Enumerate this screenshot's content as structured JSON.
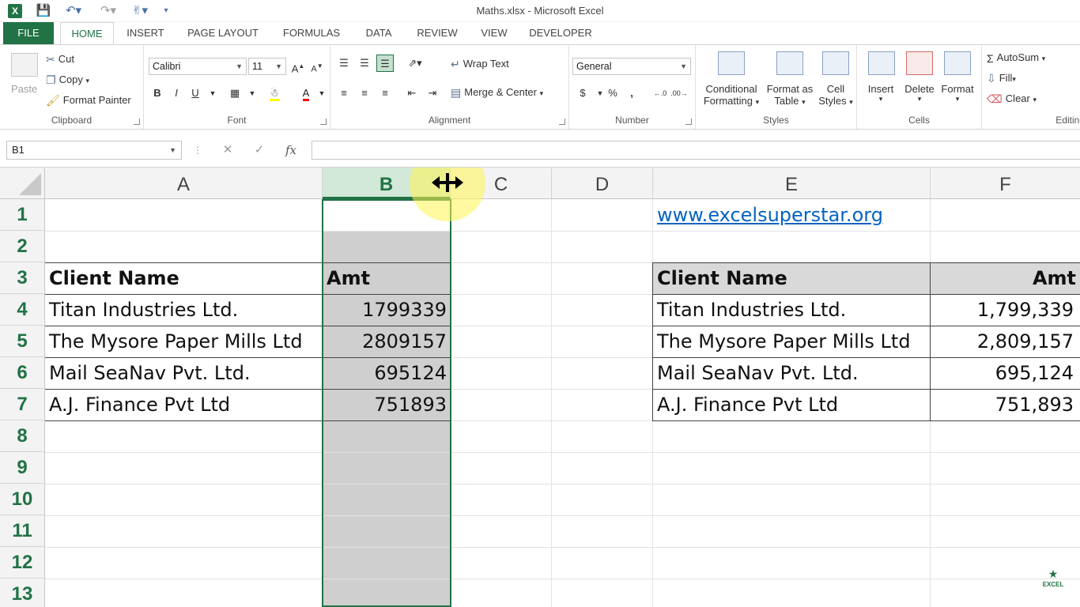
{
  "window": {
    "title": "Maths.xlsx - Microsoft Excel"
  },
  "ribbon_tabs": [
    {
      "label": "FILE"
    },
    {
      "label": "HOME"
    },
    {
      "label": "INSERT"
    },
    {
      "label": "PAGE LAYOUT"
    },
    {
      "label": "FORMULAS"
    },
    {
      "label": "DATA"
    },
    {
      "label": "REVIEW"
    },
    {
      "label": "VIEW"
    },
    {
      "label": "DEVELOPER"
    }
  ],
  "clipboard": {
    "paste": "Paste",
    "cut": "Cut",
    "copy": "Copy",
    "format_painter": "Format Painter",
    "label": "Clipboard"
  },
  "font": {
    "name": "Calibri",
    "size": "11",
    "bold": "B",
    "italic": "I",
    "underline": "U",
    "label": "Font"
  },
  "alignment": {
    "wrap_text": "Wrap Text",
    "merge_center": "Merge & Center",
    "label": "Alignment"
  },
  "number": {
    "format": "General",
    "currency": "$",
    "percent": "%",
    "comma": ",",
    "label": "Number"
  },
  "styles": {
    "conditional_1": "Conditional",
    "conditional_2": "Formatting",
    "format_table_1": "Format as",
    "format_table_2": "Table",
    "cell_styles_1": "Cell",
    "cell_styles_2": "Styles",
    "label": "Styles"
  },
  "cells": {
    "insert": "Insert",
    "delete": "Delete",
    "format": "Format",
    "label": "Cells"
  },
  "editing": {
    "autosum": "AutoSum",
    "fill": "Fill",
    "clear": "Clear",
    "label": "Editing"
  },
  "formula_bar": {
    "name_box": "B1",
    "fx": "fx",
    "formula": ""
  },
  "columns": [
    "A",
    "B",
    "C",
    "D",
    "E",
    "F"
  ],
  "rows": [
    "1",
    "2",
    "3",
    "4",
    "5",
    "6",
    "7",
    "8",
    "9",
    "10",
    "11",
    "12",
    "13"
  ],
  "sheet": {
    "link": "www.excelsuperstar.org",
    "left_table": {
      "headers": [
        "Client Name",
        "Amt"
      ],
      "rows": [
        [
          "Titan Industries Ltd.",
          "1799339"
        ],
        [
          "The Mysore Paper Mills Ltd",
          "2809157"
        ],
        [
          "Mail SeaNav Pvt. Ltd.",
          "695124"
        ],
        [
          "A.J. Finance Pvt Ltd",
          "751893"
        ]
      ]
    },
    "right_table": {
      "headers": [
        "Client Name",
        "Amt"
      ],
      "rows": [
        [
          "Titan Industries Ltd.",
          "1,799,339"
        ],
        [
          "The Mysore Paper Mills Ltd",
          "2,809,157"
        ],
        [
          "Mail SeaNav Pvt. Ltd.",
          "695,124"
        ],
        [
          "A.J. Finance Pvt Ltd",
          "751,893"
        ]
      ]
    }
  },
  "watermark": "EXCEL",
  "colors": {
    "excel_green": "#217346",
    "link_blue": "#0563c1",
    "header_fill": "#d9d9d9",
    "selection_fill": "#cfcfcf"
  }
}
